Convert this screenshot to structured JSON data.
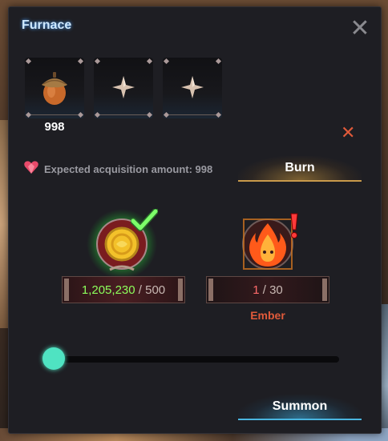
{
  "window": {
    "title": "Furnace"
  },
  "slots": [
    {
      "item": "acorn-icon",
      "count": "998"
    },
    {
      "item": "empty-slot-star-icon",
      "count": ""
    },
    {
      "item": "empty-slot-star-icon",
      "count": ""
    }
  ],
  "expected": {
    "text": "Expected acquisition amount: 998",
    "icon": "heart-gem-icon"
  },
  "burn": {
    "label": "Burn"
  },
  "coin": {
    "have": "1,205,230",
    "need": "500",
    "status_icon": "checkmark-icon"
  },
  "ember": {
    "have": "1",
    "need": "30",
    "name": "Ember",
    "status_icon": "exclamation-icon"
  },
  "slider": {
    "value": 0
  },
  "summon": {
    "label": "Summon"
  },
  "colors": {
    "accent_green": "#8cff5c",
    "accent_red": "#e05a3a",
    "slider": "#4fe3c2",
    "title_glow": "#4aa0ff"
  }
}
